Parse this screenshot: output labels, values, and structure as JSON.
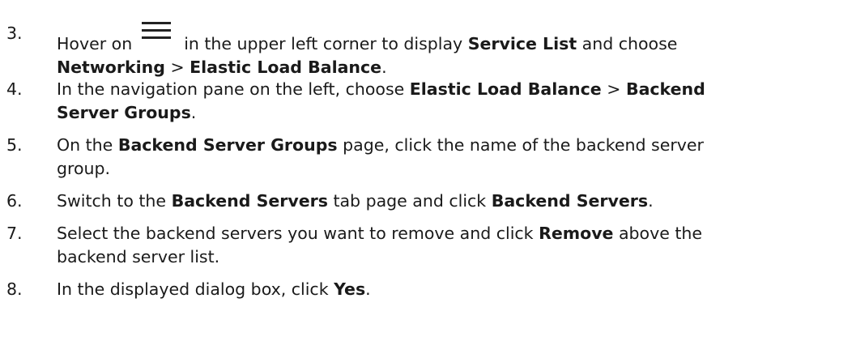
{
  "steps": [
    {
      "number": "3.",
      "line1_pre": "Hover on",
      "icon": "hamburger-menu-icon",
      "line1_post": "in the upper left corner to display ",
      "b1": "Service List",
      "t1": " and choose",
      "b2": "Networking",
      "t2": " > ",
      "b3": "Elastic Load Balance",
      "t3": "."
    },
    {
      "number": "4.",
      "t1": "In the navigation pane on the left, choose ",
      "b1": "Elastic Load Balance",
      "t2": " > ",
      "b2": "Backend",
      "b3": "Server Groups",
      "t3": "."
    },
    {
      "number": "5.",
      "t1": "On the ",
      "b1": "Backend Server Groups",
      "t2": " page, click the name of the backend server",
      "t3": "group."
    },
    {
      "number": "6.",
      "t1": "Switch to the ",
      "b1": "Backend Servers",
      "t2": " tab page and click ",
      "b2": "Backend Servers",
      "t3": "."
    },
    {
      "number": "7.",
      "t1": "Select the backend servers you want to remove and click ",
      "b1": "Remove",
      "t2": " above the",
      "t3": "backend server list."
    },
    {
      "number": "8.",
      "t1": "In the displayed dialog box, click ",
      "b1": "Yes",
      "t2": "."
    }
  ]
}
